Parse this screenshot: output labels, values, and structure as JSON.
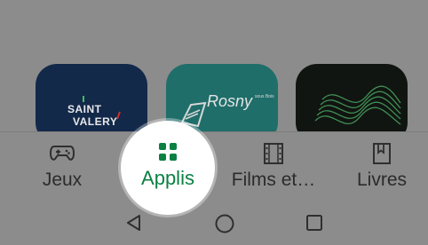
{
  "apps": [
    {
      "name": "saint-valery",
      "logo_lines": [
        "SAINT",
        "VALERY"
      ],
      "color": "#13294a"
    },
    {
      "name": "rosny",
      "logo_word": "Rosny",
      "logo_subtext": "sous Bois",
      "color": "#1f6e6a"
    },
    {
      "name": "wave-app",
      "color": "#111511"
    }
  ],
  "bottom_nav": {
    "items": [
      {
        "label": "Jeux",
        "icon": "gamepad-icon"
      },
      {
        "label": "Applis",
        "icon": "apps-grid-icon",
        "active": true
      },
      {
        "label": "Films et…",
        "icon": "film-icon"
      },
      {
        "label": "Livres",
        "icon": "book-icon"
      }
    ],
    "active_color": "#0b8043"
  },
  "system_nav": {
    "icons": [
      "back-icon",
      "home-icon",
      "recents-icon"
    ]
  }
}
